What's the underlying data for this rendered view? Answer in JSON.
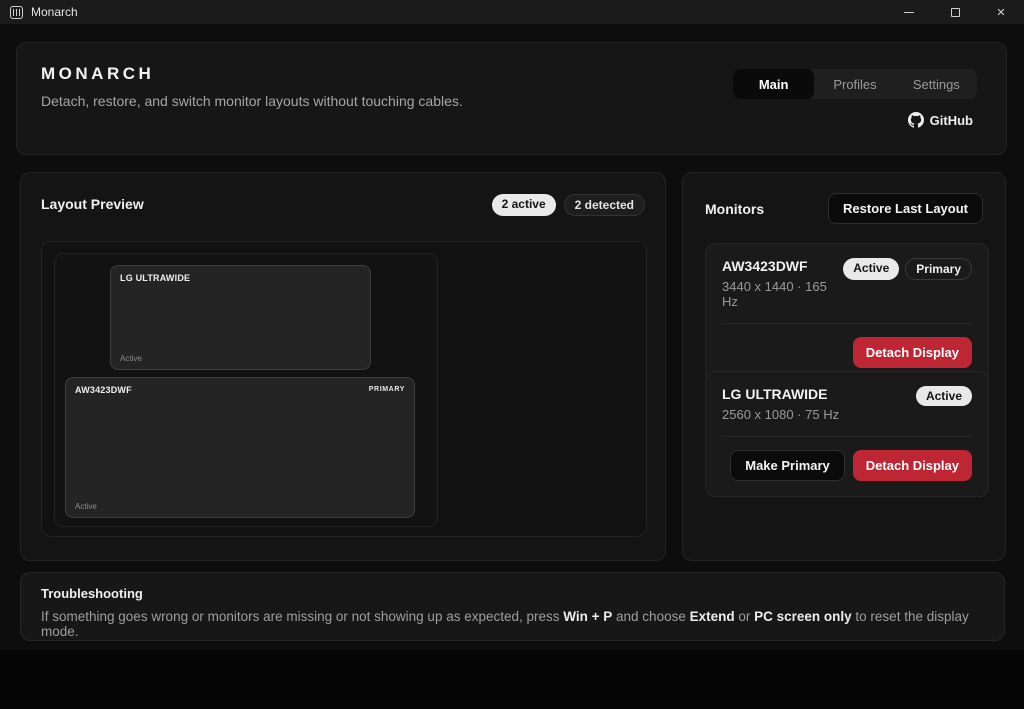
{
  "window": {
    "title": "Monarch",
    "controls": {
      "minimize": "minimize",
      "maximize": "maximize",
      "close": "✕"
    }
  },
  "header": {
    "title": "MONARCH",
    "subtitle": "Detach, restore, and switch monitor layouts without touching cables.",
    "tabs": [
      {
        "label": "Main",
        "active": true
      },
      {
        "label": "Profiles",
        "active": false
      },
      {
        "label": "Settings",
        "active": false
      }
    ],
    "github_label": "GitHub"
  },
  "layout_preview": {
    "title": "Layout Preview",
    "badges": [
      {
        "label": "2 active",
        "style": "light"
      },
      {
        "label": "2 detected",
        "style": "dark"
      }
    ],
    "monitors": [
      {
        "name": "LG ULTRAWIDE",
        "status": "Active",
        "primary_label": ""
      },
      {
        "name": "AW3423DWF",
        "status": "Active",
        "primary_label": "PRIMARY"
      }
    ]
  },
  "monitors_panel": {
    "title": "Monitors",
    "restore_button": "Restore Last Layout",
    "cards": [
      {
        "name": "AW3423DWF",
        "resolution": "3440 x 1440 · 165 Hz",
        "badges": [
          "Active",
          "Primary"
        ],
        "buttons": [
          "Detach Display"
        ]
      },
      {
        "name": "LG ULTRAWIDE",
        "resolution": "2560 x 1080 · 75 Hz",
        "badges": [
          "Active"
        ],
        "buttons": [
          "Make Primary",
          "Detach Display"
        ]
      }
    ]
  },
  "troubleshooting": {
    "title": "Troubleshooting",
    "body_segments": [
      {
        "text": "If something goes wrong or monitors are missing or not showing up as expected, press ",
        "bold": false
      },
      {
        "text": "Win + P",
        "bold": true
      },
      {
        "text": " and choose ",
        "bold": false
      },
      {
        "text": "Extend",
        "bold": true
      },
      {
        "text": " or ",
        "bold": false
      },
      {
        "text": "PC screen only",
        "bold": true
      },
      {
        "text": " to reset the display mode.",
        "bold": false
      }
    ]
  },
  "colors": {
    "accent_red": "#bf2633",
    "badge_light_bg": "#e9e9e9",
    "panel_bg": "#141414"
  }
}
